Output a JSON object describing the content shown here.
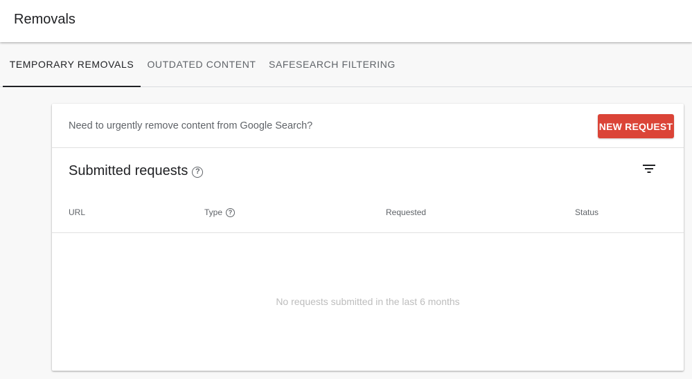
{
  "header": {
    "title": "Removals"
  },
  "tabs": [
    {
      "label": "TEMPORARY REMOVALS",
      "active": true
    },
    {
      "label": "OUTDATED CONTENT",
      "active": false
    },
    {
      "label": "SAFESEARCH FILTERING",
      "active": false
    }
  ],
  "card": {
    "prompt": "Need to urgently remove content from Google Search?",
    "new_request_label": "NEW REQUEST",
    "new_request_color": "#db4437",
    "section_title": "Submitted requests",
    "help_glyph": "?",
    "filter_icon": "filter-icon",
    "columns": {
      "url": "URL",
      "type": "Type",
      "requested": "Requested",
      "status": "Status"
    },
    "empty_message": "No requests submitted in the last 6 months"
  }
}
